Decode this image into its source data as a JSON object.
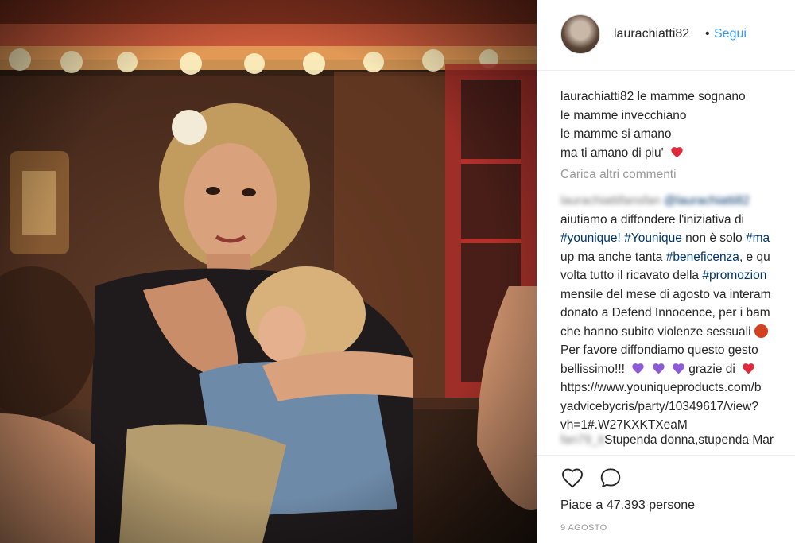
{
  "post": {
    "image_alt": "Photo of a woman holding a sleeping child at night",
    "author": "laurachiatti82",
    "separator": "•",
    "follow_label": "Segui"
  },
  "caption": {
    "username": "laurachiatti82",
    "lines": [
      "le mamme sognano",
      "le mamme invecchiano",
      "le mamme si amano",
      "ma ti amano di piu'"
    ],
    "emoji": "red-heart"
  },
  "load_more_label": "Carica altri commenti",
  "comment1": {
    "blurred_username": "laurachiattifansfan",
    "blurred_mention": "@laurachiatti82",
    "line1": "aiutiamo a diffondere l'iniziativa di",
    "tag_younique1": "#younique!",
    "tag_younique2": "#Younique",
    "text_a": "non è solo",
    "tag_ma": "#ma",
    "text_b": "up ma anche tanta",
    "tag_benef": "#beneficenza",
    "text_c": ", e qu",
    "text_d": "volta tutto il ricavato della",
    "tag_promo": "#promozion",
    "line5": "mensile del mese di agosto va interam",
    "line6": "donato a Defend Innocence, per i bam",
    "line7": "che hanno subito violenze sessuali",
    "line8": "Per favore diffondiamo questo gesto",
    "line9a": "bellissimo!!!",
    "line9b": "grazie di",
    "line10": "https://www.youniqueproducts.com/b",
    "line11": "yadvicebycris/party/10349617/view?",
    "line12": "vh=1#.W27KXKTXeaM"
  },
  "comment2": {
    "blurred_username": "fan79_it",
    "text": "Stupenda donna,stupenda Mar"
  },
  "actions": {
    "like_icon": "heart-outline-icon",
    "comment_icon": "speech-bubble-icon"
  },
  "likes_label": "Piace a 47.393 persone",
  "date_label": "9 AGOSTO",
  "colors": {
    "link_blue": "#3897f0",
    "hashtag": "#003569",
    "heart_red": "#ed4956",
    "emoji_purple": "#8e5ad8"
  }
}
